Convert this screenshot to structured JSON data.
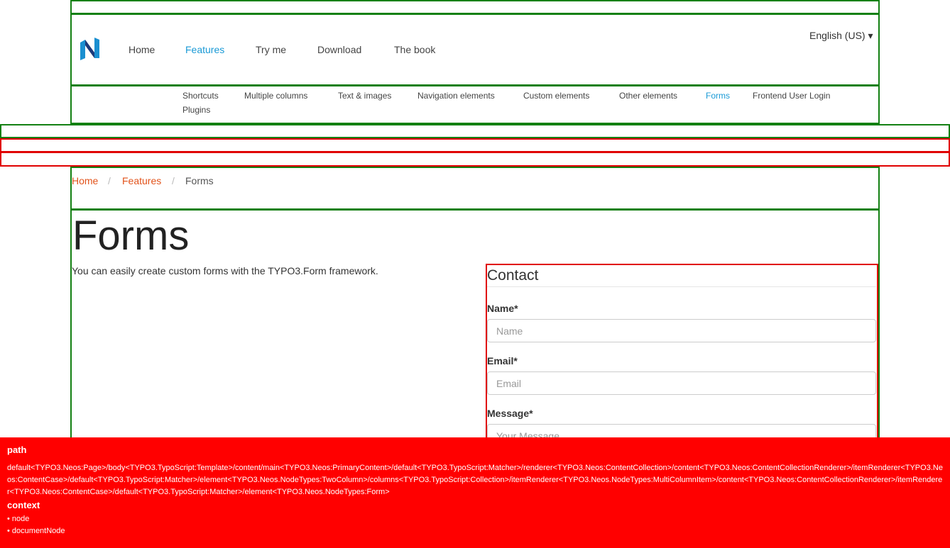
{
  "header": {
    "nav": [
      "Home",
      "Features",
      "Try me",
      "Download",
      "The book"
    ],
    "active_nav": "Features",
    "language": "English (US) ▾"
  },
  "subnav": {
    "items": [
      "Shortcuts",
      "Multiple columns",
      "Text & images",
      "Navigation elements",
      "Custom elements",
      "Other elements",
      "Forms",
      "Frontend User Login",
      "Plugins"
    ],
    "active": "Forms"
  },
  "breadcrumb": {
    "items": [
      "Home",
      "Features",
      "Forms"
    ],
    "separator": "/"
  },
  "main": {
    "title": "Forms",
    "intro": "You can easily create custom forms with the TYPO3.Form framework."
  },
  "form": {
    "title": "Contact",
    "fields": [
      {
        "label": "Name*",
        "placeholder": "Name"
      },
      {
        "label": "Email*",
        "placeholder": "Email"
      },
      {
        "label": "Message*",
        "placeholder": "Your Message"
      }
    ]
  },
  "debug": {
    "path_heading": "path",
    "path": "default<TYPO3.Neos:Page>/body<TYPO3.TypoScript:Template>/content/main<TYPO3.Neos:PrimaryContent>/default<TYPO3.TypoScript:Matcher>/renderer<TYPO3.Neos:ContentCollection>/content<TYPO3.Neos:ContentCollectionRenderer>/itemRenderer<TYPO3.Neos:ContentCase>/default<TYPO3.TypoScript:Matcher>/element<TYPO3.Neos.NodeTypes:TwoColumn>/columns<TYPO3.TypoScript:Collection>/itemRenderer<TYPO3.Neos.NodeTypes:MultiColumnItem>/content<TYPO3.Neos:ContentCollectionRenderer>/itemRenderer<TYPO3.Neos:ContentCase>/default<TYPO3.TypoScript:Matcher>/element<TYPO3.Neos.NodeTypes:Form>",
    "context_heading": "context",
    "context": [
      "node",
      "documentNode"
    ]
  },
  "colors": {
    "nav_active": "#1a9ad6",
    "breadcrumb_link": "#e2531b",
    "debug_border_green": "#138012",
    "debug_border_red": "#e00000",
    "debug_panel": "#ff0000"
  }
}
